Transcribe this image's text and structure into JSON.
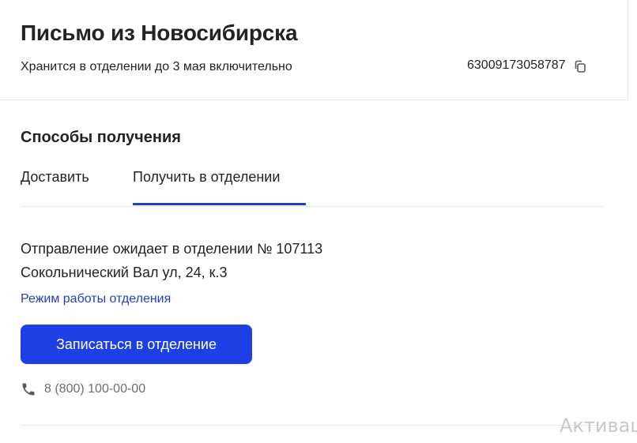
{
  "header": {
    "title": "Письмо из Новосибирска",
    "storage_note": "Хранится в отделении до 3 мая включительно",
    "tracking_number": "63009173058787"
  },
  "pickup_section": {
    "title": "Способы получения",
    "tabs": [
      {
        "label": "Доставить",
        "selected": false
      },
      {
        "label": "Получить в отделении",
        "selected": true
      }
    ],
    "notice_line1": "Отправление ожидает в отделении № 107113",
    "notice_line2": "Сокольнический Вал ул, 24, к.3",
    "hours_link": "Режим работы отделения",
    "signup_button": "Записаться в отделение",
    "phone": "8 (800) 100-00-00"
  },
  "watermark": "Активаці",
  "icons": {
    "copy": "copy-icon",
    "phone": "phone-icon"
  },
  "colors": {
    "accent": "#1f3fe6",
    "link": "#1f3fc4",
    "text": "#222327",
    "muted": "#6b6e73",
    "divider": "#e6e6e9"
  }
}
